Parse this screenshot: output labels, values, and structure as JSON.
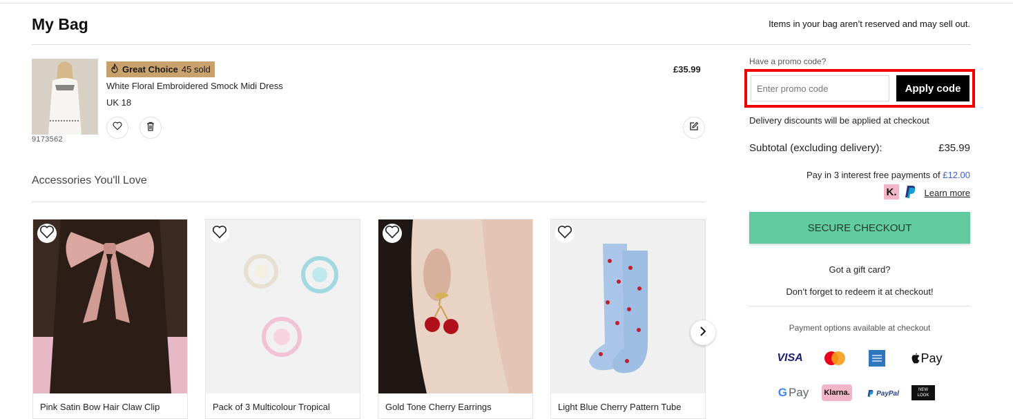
{
  "header": {
    "title": "My Bag",
    "notice": "Items in your bag aren’t reserved and may sell out."
  },
  "item": {
    "badge_label": "Great Choice",
    "badge_count": "45 sold",
    "name": "White Floral Embroidered Smock Midi Dress",
    "size": "UK 18",
    "sku": "9173562",
    "price": "£35.99"
  },
  "accessories": {
    "title": "Accessories You'll Love",
    "products": [
      {
        "name": "Pink Satin Bow Hair Claw Clip"
      },
      {
        "name": "Pack of 3 Multicolour Tropical"
      },
      {
        "name": "Gold Tone Cherry Earrings"
      },
      {
        "name": "Light Blue Cherry Pattern Tube"
      }
    ]
  },
  "summary": {
    "promo_label": "Have a promo code?",
    "promo_placeholder": "Enter promo code",
    "apply_label": "Apply code",
    "delivery_note": "Delivery discounts will be applied at checkout",
    "subtotal_label": "Subtotal (excluding delivery):",
    "subtotal_value": "£35.99",
    "pay3_text": "Pay in 3 interest free payments of",
    "pay3_amount": "£12.00",
    "klarna_k": "K.",
    "learn_more": "Learn more",
    "checkout_label": "SECURE CHECKOUT",
    "gift_q": "Got a gift card?",
    "gift_note": "Don’t forget to redeem it at checkout!",
    "payment_options_label": "Payment options available at checkout",
    "payment_logos": {
      "visa": "VISA",
      "apple_pay": "Pay",
      "google_pay": "Pay",
      "klarna": "Klarna.",
      "paypal": "PayPal",
      "newlook_top": "NEW",
      "newlook_bottom": "LOOK"
    }
  },
  "colors": {
    "accent_checkout": "#63cba0",
    "badge": "#c9a16c",
    "highlight": "#f00000",
    "link_blue": "#3b5ed8"
  }
}
